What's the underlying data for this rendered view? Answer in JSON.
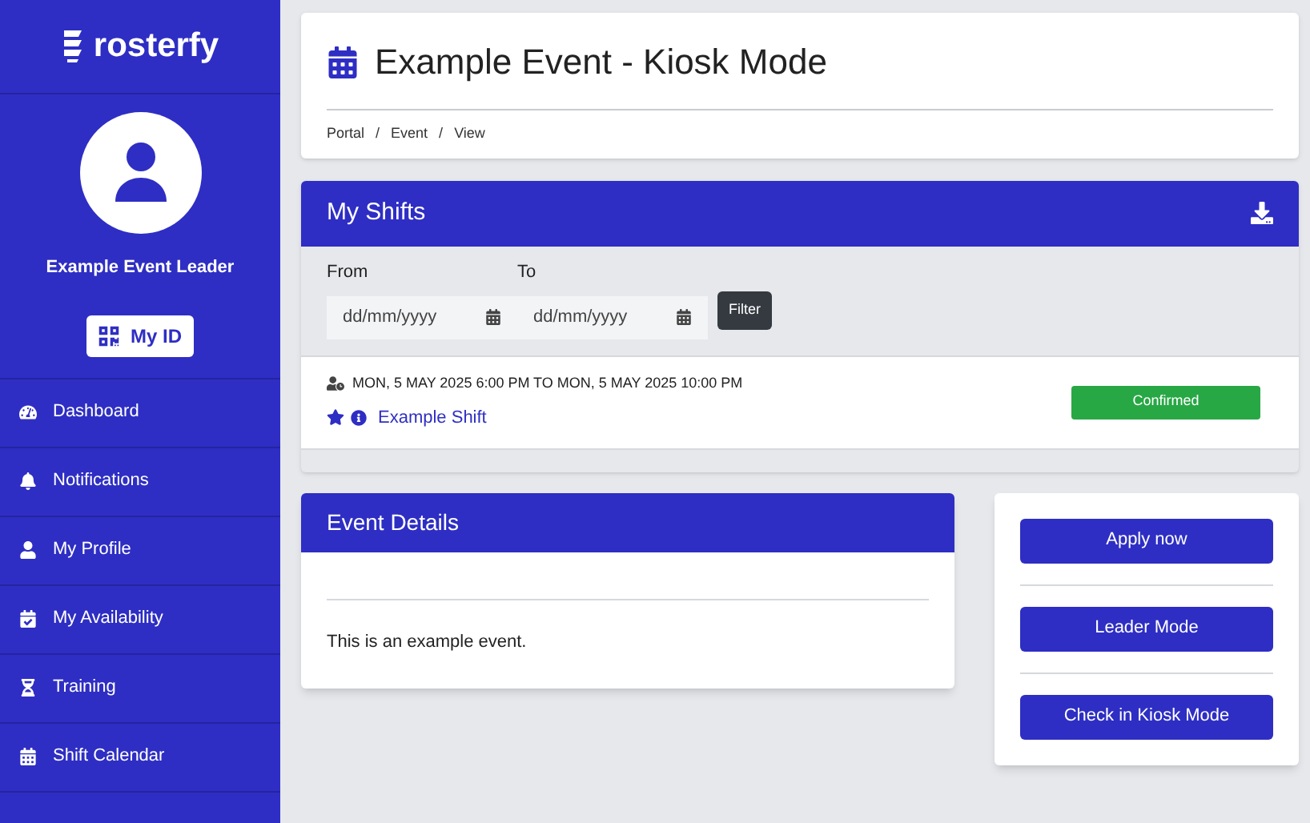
{
  "sidebar": {
    "logo": "rosterfy",
    "user_name": "Example Event Leader",
    "id_button": "My ID",
    "items": [
      {
        "label": "Dashboard"
      },
      {
        "label": "Notifications"
      },
      {
        "label": "My Profile"
      },
      {
        "label": "My Availability"
      },
      {
        "label": "Training"
      },
      {
        "label": "Shift Calendar"
      }
    ]
  },
  "header": {
    "title": "Example Event - Kiosk Mode",
    "breadcrumbs": [
      "Portal",
      "Event",
      "View"
    ],
    "breadcrumb_separator": "/"
  },
  "my_shifts": {
    "title": "My Shifts",
    "from_label": "From",
    "to_label": "To",
    "from_placeholder": "dd/mm/yyyy",
    "to_placeholder": "dd/mm/yyyy",
    "filter_button": "Filter",
    "shifts": [
      {
        "time": "MON, 5 MAY 2025 6:00 PM TO MON, 5 MAY 2025 10:00 PM",
        "name": "Example Shift",
        "status": "Confirmed",
        "color": "#28a745"
      }
    ]
  },
  "event_details": {
    "title": "Event Details",
    "description": "This is an example event."
  },
  "actions": [
    "Apply now",
    "Leader Mode",
    "Check in Kiosk Mode"
  ]
}
